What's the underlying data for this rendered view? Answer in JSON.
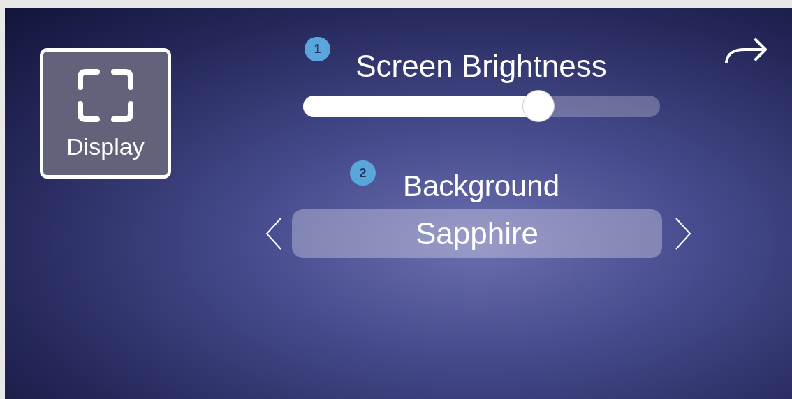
{
  "sidebar": {
    "items": [
      {
        "label": "Display",
        "selected": true
      }
    ]
  },
  "brightness": {
    "badge": "1",
    "title": "Screen Brightness",
    "level": 0.66
  },
  "background": {
    "badge": "2",
    "title": "Background",
    "value": "Sapphire"
  }
}
